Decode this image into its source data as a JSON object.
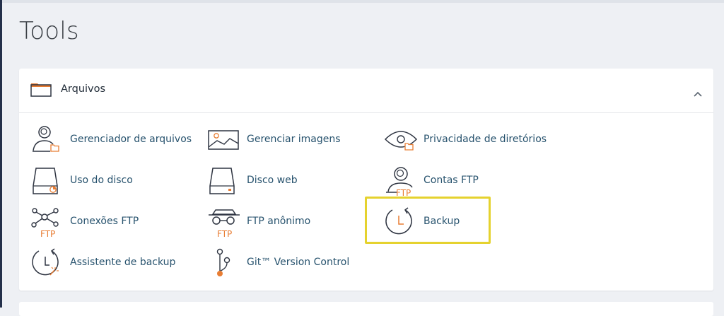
{
  "page": {
    "title": "Tools"
  },
  "section": {
    "title": "Arquivos",
    "collapsed": false
  },
  "colors": {
    "accent": "#e87d33",
    "link": "#28536e",
    "highlight": "#e5d22e"
  },
  "tools": [
    {
      "label": "Gerenciador de arquivos",
      "icon": "file-manager-icon"
    },
    {
      "label": "Gerenciar imagens",
      "icon": "images-icon"
    },
    {
      "label": "Privacidade de diretórios",
      "icon": "directory-privacy-icon"
    },
    {
      "label": "Uso do disco",
      "icon": "disk-usage-icon"
    },
    {
      "label": "Disco web",
      "icon": "web-disk-icon"
    },
    {
      "label": "Contas FTP",
      "icon": "ftp-accounts-icon"
    },
    {
      "label": "Conexões FTP",
      "icon": "ftp-connections-icon"
    },
    {
      "label": "FTP anônimo",
      "icon": "anonymous-ftp-icon"
    },
    {
      "label": "Backup",
      "icon": "backup-icon",
      "highlighted": true
    },
    {
      "label": "Assistente de backup",
      "icon": "backup-wizard-icon"
    },
    {
      "label": "Git™ Version Control",
      "icon": "git-icon"
    }
  ],
  "icon_text": {
    "ftp": "FTP"
  }
}
